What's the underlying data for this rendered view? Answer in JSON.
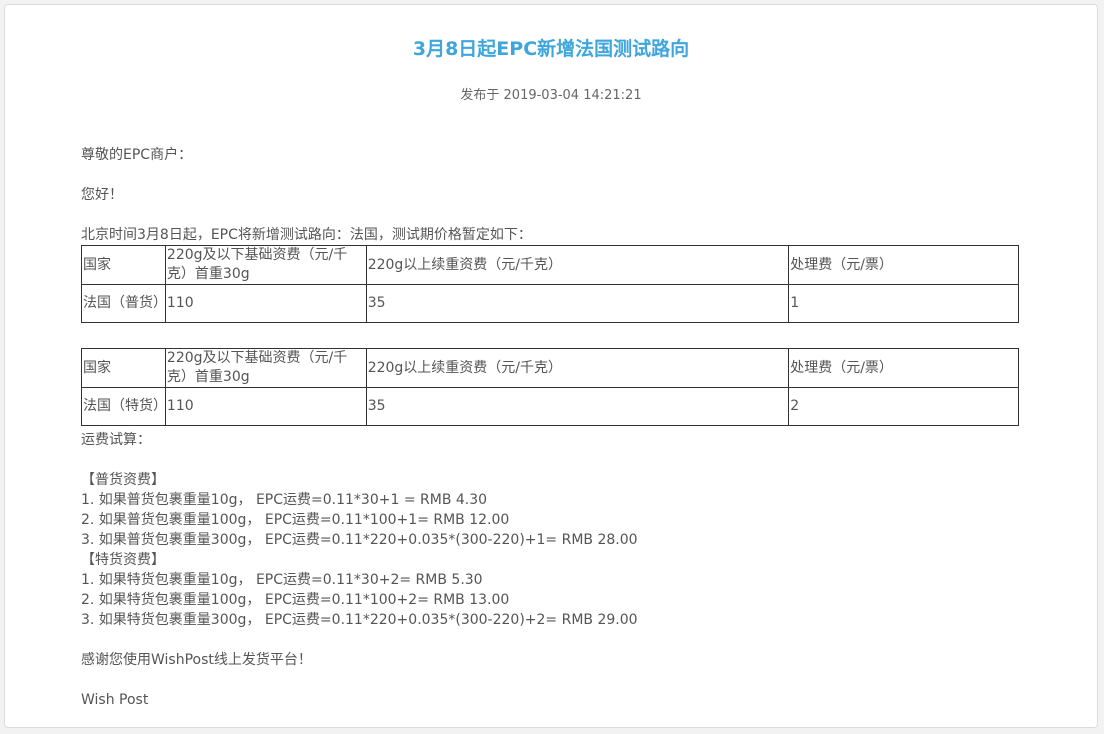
{
  "article": {
    "title": "3月8日起EPC新增法国测试路向",
    "published": "发布于 2019-03-04 14:21:21"
  },
  "body": {
    "greeting": "尊敬的EPC商户：",
    "hello": "您好！",
    "intro": "北京时间3月8日起，EPC将新增测试路向：法国，测试期价格暂定如下："
  },
  "tables": [
    {
      "headers": [
        "国家",
        "220g及以下基础资费（元/千克）首重30g",
        "220g以上续重资费（元/千克）",
        "处理费（元/票）"
      ],
      "row": [
        "法国（普货）",
        "110",
        "35",
        "1"
      ]
    },
    {
      "headers": [
        "国家",
        "220g及以下基础资费（元/千克）首重30g",
        "220g以上续重资费（元/千克）",
        "处理费（元/票）"
      ],
      "row": [
        "法国（特货）",
        "110",
        "35",
        "2"
      ]
    }
  ],
  "calc": {
    "heading": "运费试算：",
    "general_heading": "【普货资费】",
    "general": [
      "1. 如果普货包裹重量10g，  EPC运费=0.11*30+1 = RMB 4.30",
      "2. 如果普货包裹重量100g，  EPC运费=0.11*100+1= RMB 12.00",
      "3. 如果普货包裹重量300g，  EPC运费=0.11*220+0.035*(300-220)+1= RMB 28.00"
    ],
    "special_heading": "【特货资费】",
    "special": [
      "1. 如果特货包裹重量10g，  EPC运费=0.11*30+2= RMB 5.30",
      "2. 如果特货包裹重量100g，  EPC运费=0.11*100+2= RMB 13.00",
      "3. 如果特货包裹重量300g，  EPC运费=0.11*220+0.035*(300-220)+2= RMB 29.00"
    ]
  },
  "footer": {
    "thanks": "感谢您使用WishPost线上发货平台！",
    "signature": "Wish Post"
  },
  "colors": {
    "title": "#3ea6dc",
    "text": "#555555",
    "table_border": "#333333"
  }
}
